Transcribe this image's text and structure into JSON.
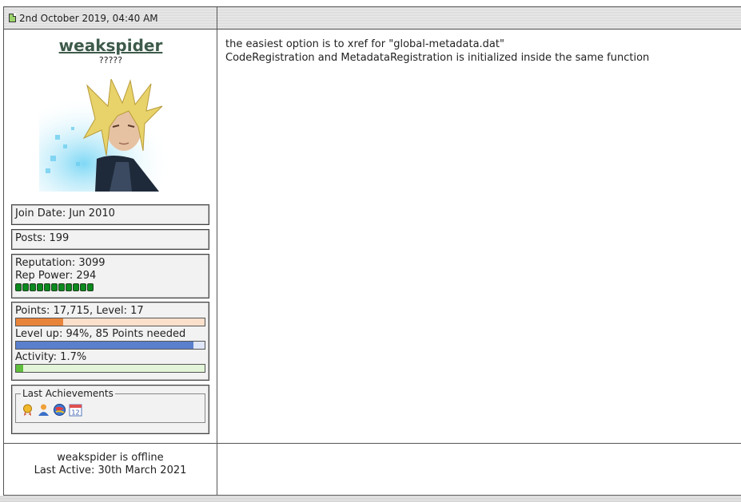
{
  "post": {
    "date": "2nd October 2019, 04:40 AM",
    "message_lines": [
      "the easiest option is to xref for \"global-metadata.dat\"",
      "CodeRegistration and MetadataRegistration is initialized inside the same function"
    ]
  },
  "user": {
    "name": "weakspider",
    "title": "?????",
    "join_date": "Join Date: Jun 2010",
    "posts": "Posts: 199",
    "reputation": "Reputation: 3099",
    "rep_power": "Rep Power: 294",
    "rep_gems": 11,
    "points": {
      "label": "Points: 17,715, Level: 17",
      "fraction": 0.25
    },
    "level_up": {
      "label": "Level up: 94%, 85 Points needed",
      "fraction": 0.94
    },
    "activity": {
      "label": "Activity: 1.7%",
      "fraction": 0.04
    },
    "achievements_label": "Last Achievements",
    "achievement_icons": [
      "medal-icon",
      "user-award-icon",
      "globe-icon",
      "calendar-icon"
    ],
    "status": "weakspider is offline",
    "last_active": "Last Active: 30th March 2021"
  },
  "colors": {
    "points_fill": "#e8843a",
    "points_bg": "#fbe0cc",
    "levelup_fill": "#5a7fcc",
    "levelup_bg": "#dfe6f7",
    "activity_fill": "#5fbf3c",
    "activity_bg": "#e2f5d8"
  }
}
